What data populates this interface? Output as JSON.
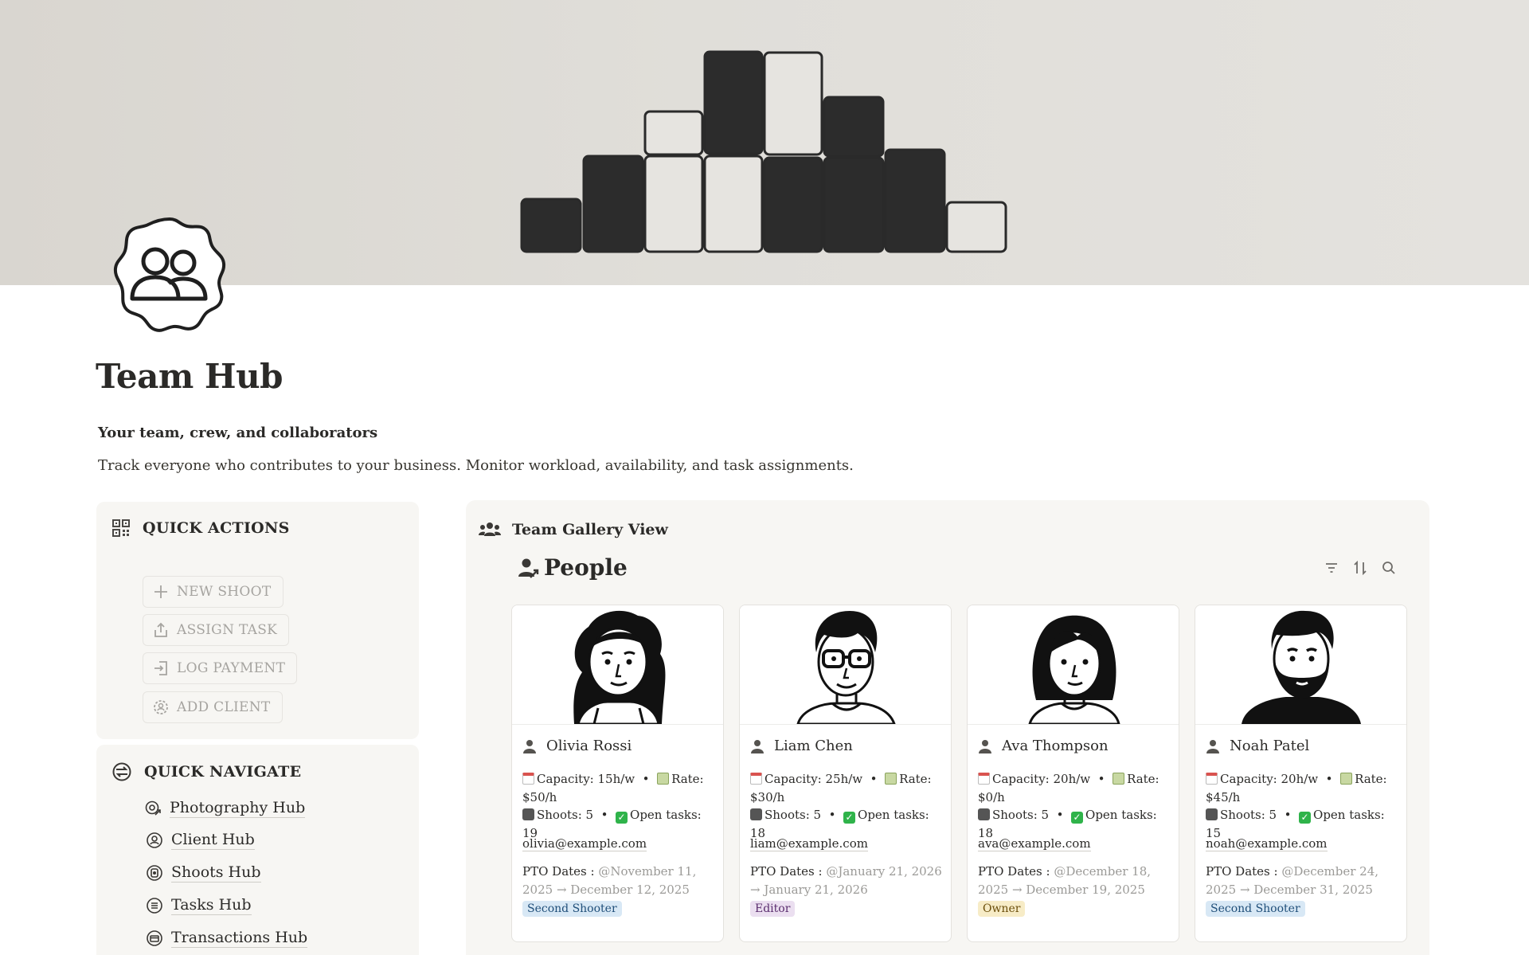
{
  "page": {
    "title": "Team Hub",
    "subtitle": "Your team, crew, and collaborators",
    "description": "Track everyone who contributes to your business. Monitor workload, availability, and task assignments."
  },
  "quick_actions": {
    "heading": "QUICK ACTIONS",
    "buttons": [
      {
        "label": "NEW SHOOT",
        "icon": "plus-icon"
      },
      {
        "label": "ASSIGN TASK",
        "icon": "share-icon"
      },
      {
        "label": "LOG PAYMENT",
        "icon": "login-icon"
      },
      {
        "label": "ADD CLIENT",
        "icon": "client-icon"
      }
    ]
  },
  "quick_navigate": {
    "heading": "QUICK NAVIGATE",
    "items": [
      {
        "label": "Photography Hub",
        "icon": "photography-hub-icon"
      },
      {
        "label": "Client Hub",
        "icon": "client-hub-icon"
      },
      {
        "label": "Shoots Hub",
        "icon": "shoots-hub-icon"
      },
      {
        "label": "Tasks Hub",
        "icon": "tasks-hub-icon"
      },
      {
        "label": "Transactions Hub",
        "icon": "transactions-hub-icon"
      }
    ]
  },
  "gallery": {
    "heading": "Team Gallery View",
    "database_title": "People",
    "people": [
      {
        "name": "Olivia Rossi",
        "capacity": "Capacity: 15h/w",
        "rate": "Rate: $50/h",
        "shoots": "Shoots: 5",
        "open_tasks": "Open tasks: 19",
        "email": "olivia@example.com",
        "pto_label": "PTO Dates :",
        "pto_dates": "@November 11, 2025 → December 12, 2025",
        "role": "Second Shooter",
        "role_bg": "#d8e8f5",
        "role_fg": "#1f4e79"
      },
      {
        "name": "Liam Chen",
        "capacity": "Capacity: 25h/w",
        "rate": "Rate: $30/h",
        "shoots": "Shoots: 5",
        "open_tasks": "Open tasks: 18",
        "email": "liam@example.com",
        "pto_label": "PTO Dates :",
        "pto_dates": "@January 21, 2026 → January 21, 2026",
        "role": "Editor",
        "role_bg": "#ebdff0",
        "role_fg": "#5a2d6e"
      },
      {
        "name": "Ava Thompson",
        "capacity": "Capacity: 20h/w",
        "rate": "Rate: $0/h",
        "shoots": "Shoots: 5",
        "open_tasks": "Open tasks: 18",
        "email": "ava@example.com",
        "pto_label": "PTO Dates :",
        "pto_dates": "@December 18, 2025 → December 19, 2025",
        "role": "Owner",
        "role_bg": "#f7ecc7",
        "role_fg": "#6b4e0b"
      },
      {
        "name": "Noah Patel",
        "capacity": "Capacity: 20h/w",
        "rate": "Rate: $45/h",
        "shoots": "Shoots: 5",
        "open_tasks": "Open tasks: 15",
        "email": "noah@example.com",
        "pto_label": "PTO Dates :",
        "pto_dates": "@December 24, 2025 → December 31, 2025",
        "role": "Second Shooter",
        "role_bg": "#d8e8f5",
        "role_fg": "#1f4e79"
      }
    ]
  }
}
